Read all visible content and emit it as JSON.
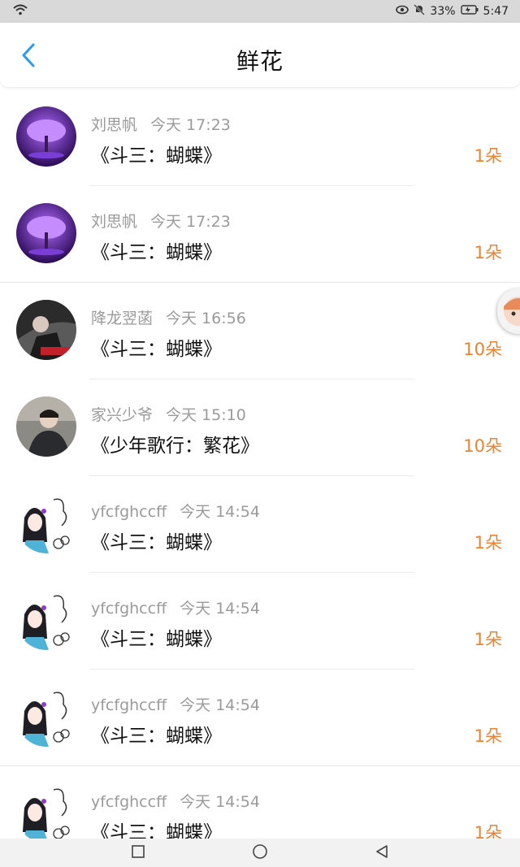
{
  "status": {
    "battery": "33%",
    "time": "5:47"
  },
  "header": {
    "title": "鲜花"
  },
  "gifts": [
    {
      "name": "刘思帆",
      "time": "今天 17:23",
      "work": "《斗三：蝴蝶》",
      "count": "1朵",
      "avatar": "purple-tree-avatar"
    },
    {
      "name": "刘思帆",
      "time": "今天 17:23",
      "work": "《斗三：蝴蝶》",
      "count": "1朵",
      "avatar": "purple-tree-avatar"
    },
    {
      "name": "降龙翌菡",
      "time": "今天 16:56",
      "work": "《斗三：蝴蝶》",
      "count": "10朵",
      "avatar": "dark-photo-avatar"
    },
    {
      "name": "家兴少爷",
      "time": "今天 15:10",
      "work": "《少年歌行：繁花》",
      "count": "10朵",
      "avatar": "boy-photo-avatar"
    },
    {
      "name": "yfcfghccff",
      "time": "今天 14:54",
      "work": "《斗三：蝴蝶》",
      "count": "1朵",
      "avatar": "anime-girl-avatar"
    },
    {
      "name": "yfcfghccff",
      "time": "今天 14:54",
      "work": "《斗三：蝴蝶》",
      "count": "1朵",
      "avatar": "anime-girl-avatar"
    },
    {
      "name": "yfcfghccff",
      "time": "今天 14:54",
      "work": "《斗三：蝴蝶》",
      "count": "1朵",
      "avatar": "anime-girl-avatar"
    },
    {
      "name": "yfcfghccff",
      "time": "今天 14:54",
      "work": "《斗三：蝴蝶》",
      "count": "1朵",
      "avatar": "anime-girl-avatar"
    }
  ],
  "colors": {
    "accent_blue": "#2b9af3",
    "count_orange": "#f0822e"
  },
  "icons": {
    "back": "chevron-left-icon",
    "nav_recent": "square-icon",
    "nav_home": "circle-icon",
    "nav_back": "triangle-back-icon"
  }
}
